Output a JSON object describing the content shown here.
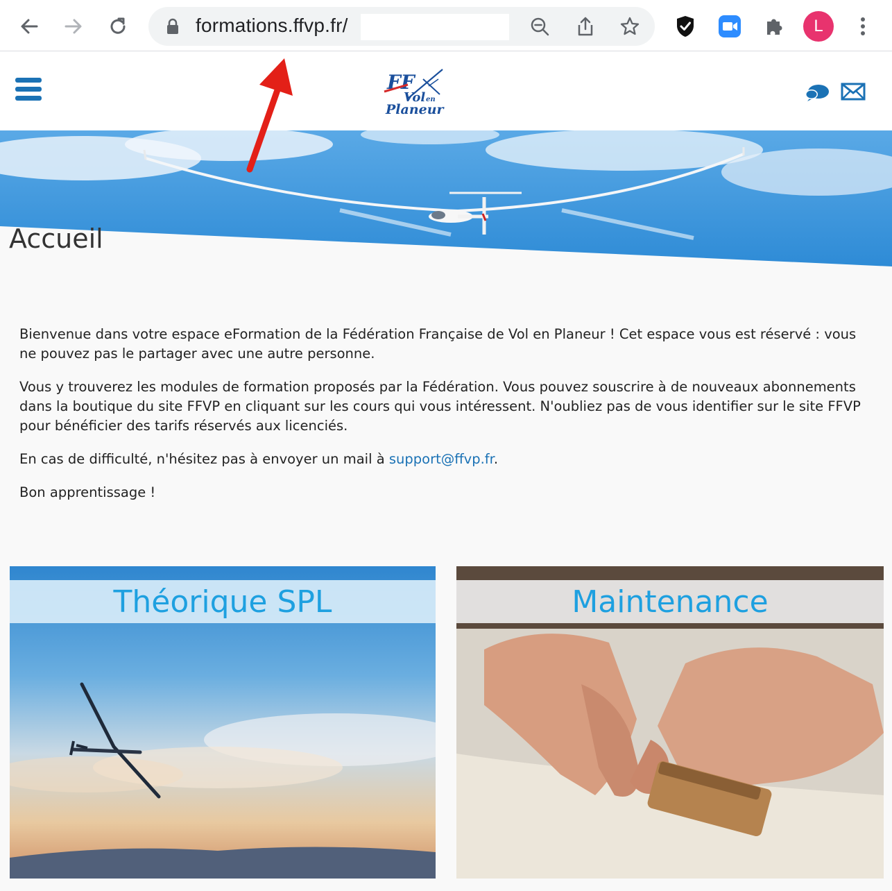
{
  "browser": {
    "url": "formations.ffvp.fr/",
    "profile_initial": "L",
    "icons": [
      "back-icon",
      "forward-icon",
      "reload-icon",
      "lock-icon",
      "zoom-out-icon",
      "share-icon",
      "bookmark-star-icon",
      "shield-extension-icon",
      "zoom-video-extension-icon",
      "puzzle-extensions-icon",
      "kebab-menu-icon"
    ]
  },
  "site": {
    "logo_text_ff": "FF",
    "logo_text_vol": "Vol",
    "logo_text_en": "en",
    "logo_text_planeur": "Planeur",
    "page_title": "Accueil",
    "link_color": "#1b72b5",
    "accent_color": "#1ea0e0"
  },
  "content": {
    "p1": "Bienvenue dans votre espace eFormation de la Fédération Française de Vol en Planeur ! Cet espace vous est réservé : vous ne pouvez pas le partager avec une autre personne.",
    "p2": "Vous y trouverez les modules de formation proposés par la Fédération. Vous pouvez souscrire à de nouveaux abonnements dans la boutique du site FFVP en cliquant sur les cours qui vous intéressent. N'oubliez pas de vous identifier sur le site FFVP pour bénéficier des tarifs réservés aux licenciés.",
    "p3_before": " En cas de difficulté, n'hésitez pas à envoyer un mail à ",
    "p3_link": "support@ffvp.fr",
    "p3_after": ".",
    "p4": "Bon apprentissage !"
  },
  "courses": [
    {
      "title": "Théorique SPL"
    },
    {
      "title": "Maintenance"
    }
  ]
}
